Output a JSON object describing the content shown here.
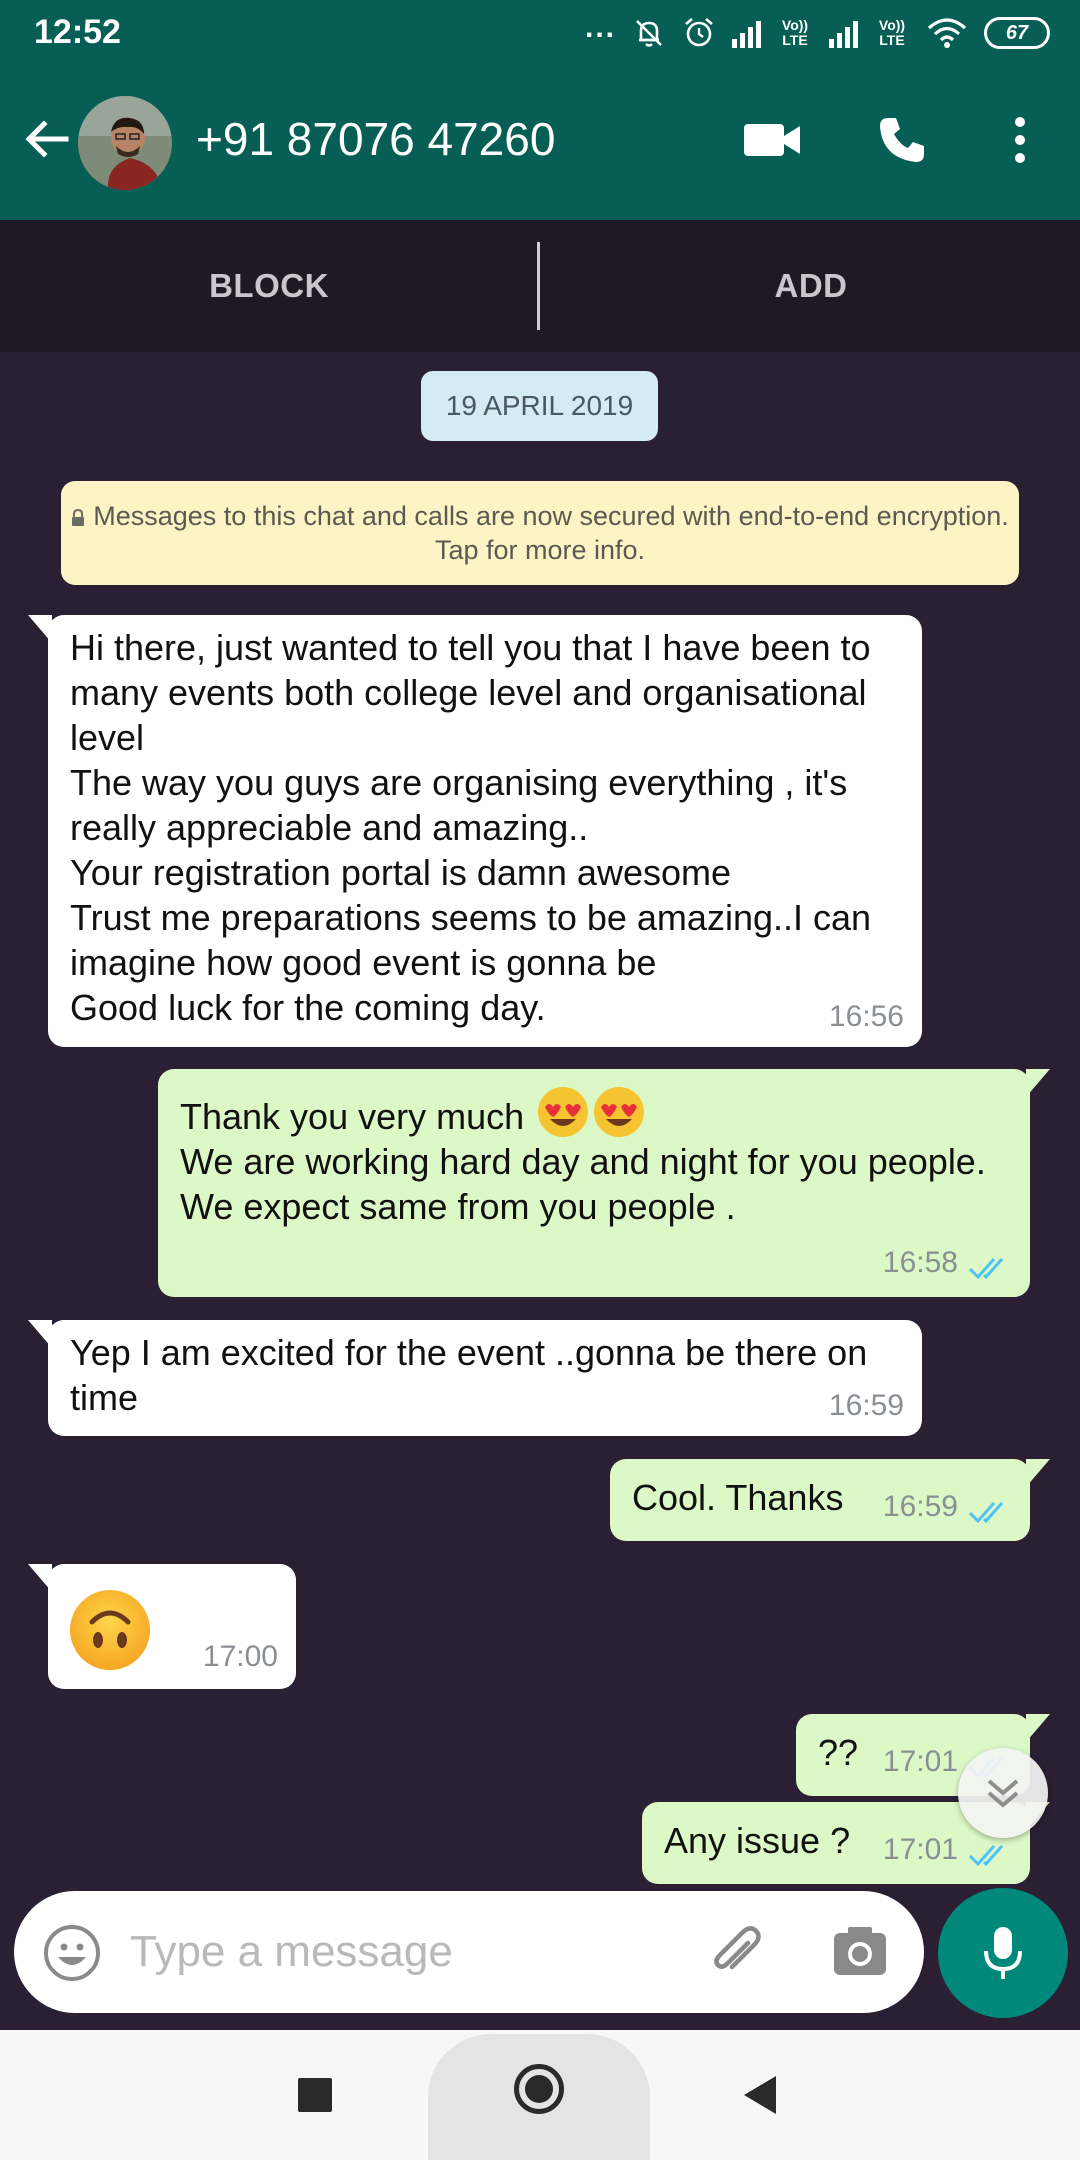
{
  "status_bar": {
    "time": "12:52",
    "dots": "...",
    "lte_1": "Vo)) LTE",
    "lte_2": "Vo)) LTE",
    "battery": "67"
  },
  "header": {
    "contact": "+91 87076 47260"
  },
  "actions": {
    "block": "BLOCK",
    "add": "ADD"
  },
  "chat": {
    "date": "19 APRIL 2019",
    "encryption_notice": "Messages to this chat and calls are now secured with end-to-end encryption. Tap for more info.",
    "messages": [
      {
        "direction": "incoming",
        "text": "Hi there, just wanted to tell you that I have been to many events both college level and organisational level\nThe way you guys are organising everything , it's really appreciable and amazing..\nYour registration portal is damn awesome\nTrust me preparations seems to be amazing..I can imagine how good event is gonna be\nGood luck for the coming day.",
        "time": "16:56"
      },
      {
        "direction": "outgoing",
        "text_line1": "Thank you very much",
        "text_rest": "We are working hard day and night for you people. We expect same from you people .",
        "emoji": "heart-eyes x2",
        "time": "16:58",
        "status": "read"
      },
      {
        "direction": "incoming",
        "text": "Yep I am excited for the event ..gonna be there on time",
        "time": "16:59"
      },
      {
        "direction": "outgoing",
        "text": "Cool. Thanks",
        "time": "16:59",
        "status": "read"
      },
      {
        "direction": "incoming",
        "emoji": "upside-down-face",
        "time": "17:00"
      },
      {
        "direction": "outgoing",
        "text": "??",
        "time": "17:01",
        "status": "read"
      },
      {
        "direction": "outgoing",
        "text": "Any issue ?",
        "time": "17:01",
        "status": "read"
      }
    ]
  },
  "composer": {
    "placeholder": "Type a message"
  },
  "colors": {
    "header": "#075e54",
    "chat_background": "#2a1f33",
    "outgoing_bubble": "#dcf8c6",
    "incoming_bubble": "#ffffff",
    "read_ticks": "#4fc3f7",
    "mic_button": "#00897b"
  }
}
